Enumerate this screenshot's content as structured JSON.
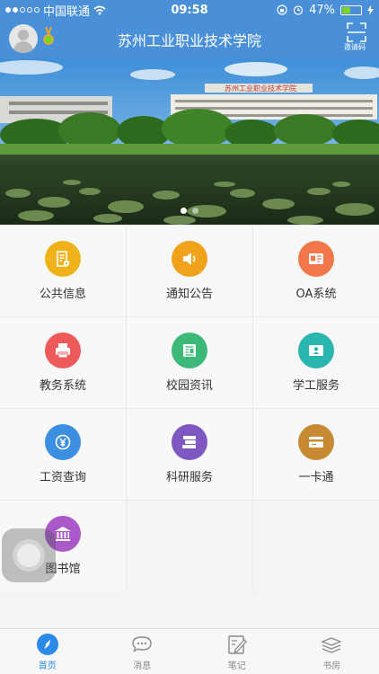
{
  "status_bar": {
    "carrier": "中国联通",
    "time": "09:58",
    "battery": "47%",
    "battery_level": 0.47,
    "icons": [
      "signal-icon",
      "wifi-icon",
      "lock-rotation-icon",
      "alarm-icon",
      "battery-icon",
      "charging-icon"
    ]
  },
  "header": {
    "title": "苏州工业职业技术学院",
    "scan_label": "邀请码"
  },
  "banner": {
    "sign_text": "苏州工业职业技术学院",
    "slide_count": 2,
    "active_slide": 0
  },
  "grid": {
    "items": [
      {
        "label": "公共信息",
        "icon": "document-gear-icon",
        "color": "#f0b21b"
      },
      {
        "label": "通知公告",
        "icon": "speaker-icon",
        "color": "#f0a21a"
      },
      {
        "label": "OA系统",
        "icon": "id-card-icon",
        "color": "#f2784b"
      },
      {
        "label": "教务系统",
        "icon": "printer-icon",
        "color": "#ee5a5a"
      },
      {
        "label": "校园资讯",
        "icon": "newspaper-icon",
        "color": "#3cb878"
      },
      {
        "label": "学工服务",
        "icon": "student-card-icon",
        "color": "#2bb5b0"
      },
      {
        "label": "工资查询",
        "icon": "yen-coin-icon",
        "color": "#3c8fe0"
      },
      {
        "label": "科研服务",
        "icon": "books-stack-icon",
        "color": "#7e57c2"
      },
      {
        "label": "一卡通",
        "icon": "bank-card-icon",
        "color": "#c78a32"
      },
      {
        "label": "图书馆",
        "icon": "library-building-icon",
        "color": "#a95ac8"
      }
    ]
  },
  "tabbar": {
    "tabs": [
      {
        "label": "首页",
        "icon": "compass-icon",
        "active": true
      },
      {
        "label": "消息",
        "icon": "chat-bubble-icon",
        "active": false
      },
      {
        "label": "笔记",
        "icon": "note-edit-icon",
        "active": false
      },
      {
        "label": "书房",
        "icon": "book-shelf-icon",
        "active": false
      }
    ]
  },
  "colors": {
    "primary": "#4a90d9",
    "tab_active": "#2a8ae6"
  }
}
